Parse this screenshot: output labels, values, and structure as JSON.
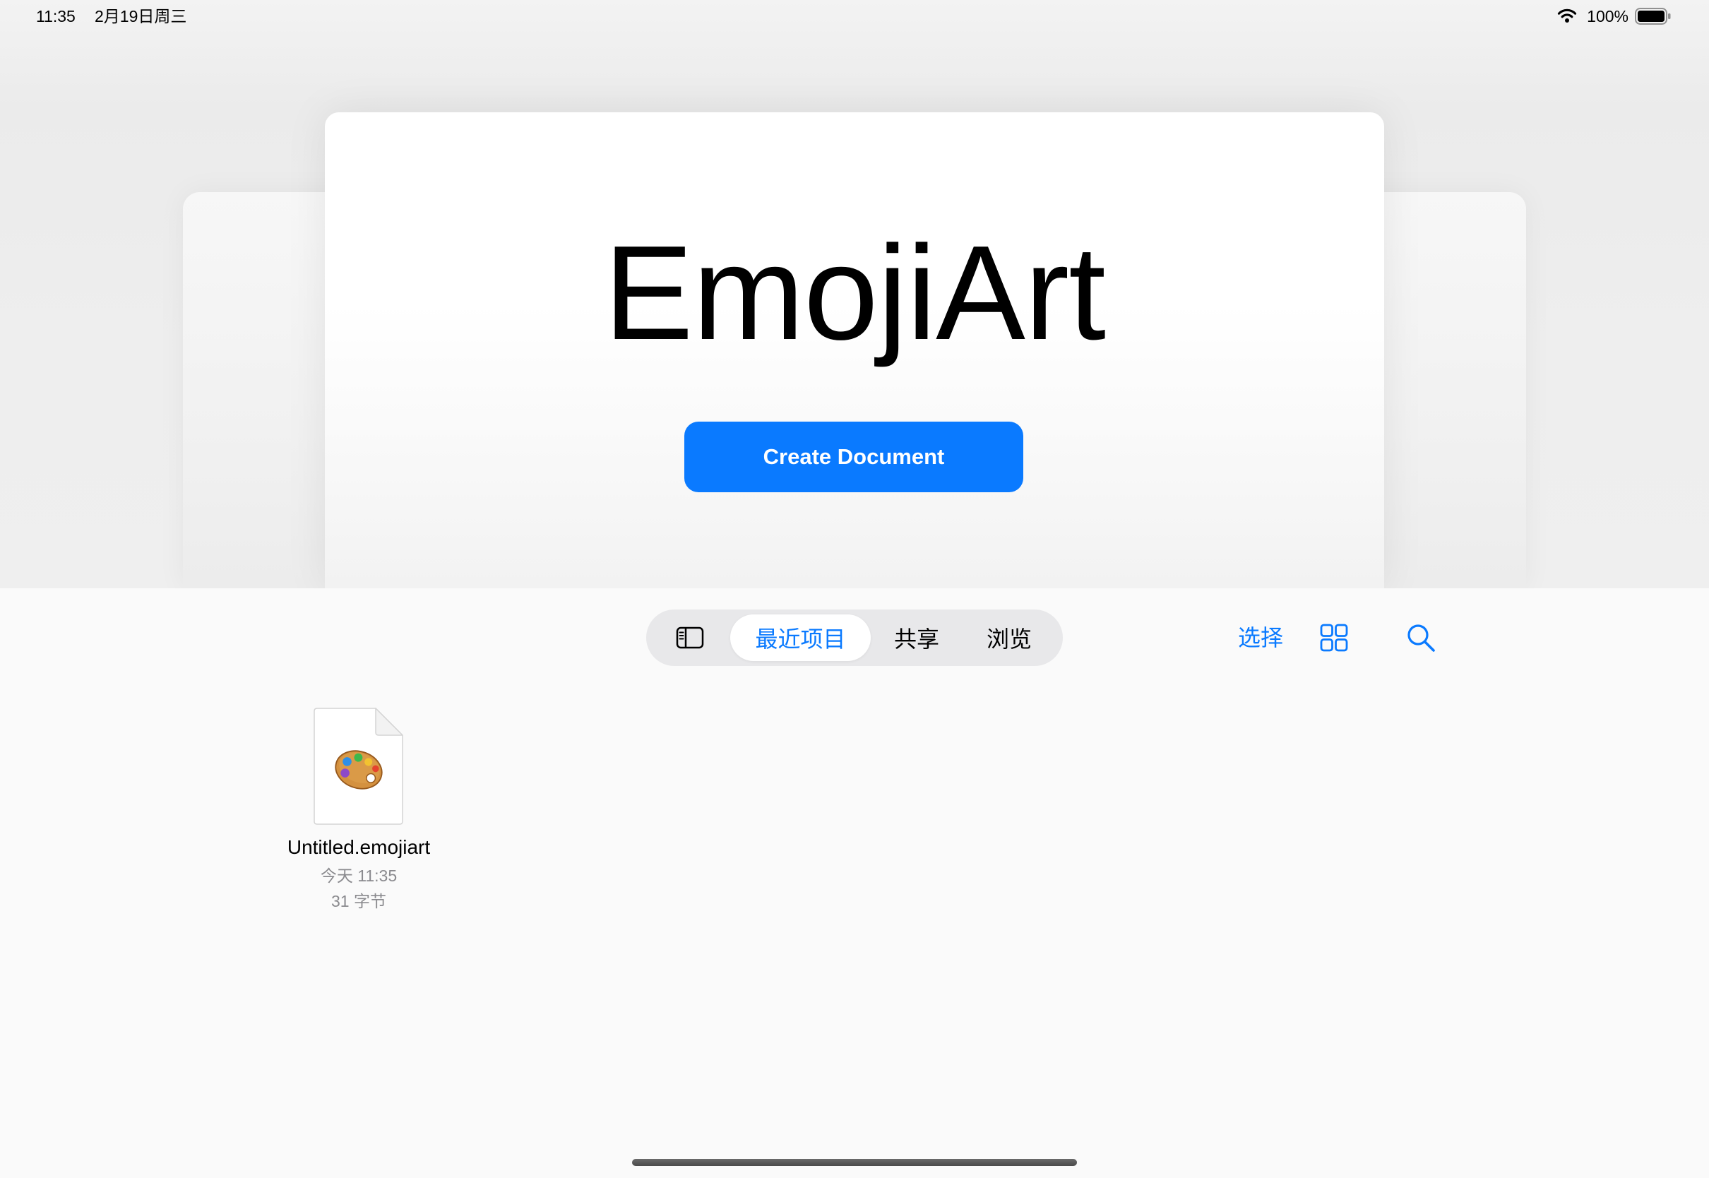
{
  "status_bar": {
    "time": "11:35",
    "date": "2月19日周三",
    "battery_percent": "100%",
    "icons": [
      "wifi-icon",
      "battery-icon"
    ]
  },
  "hero": {
    "title": "EmojiArt",
    "create_button_label": "Create Document"
  },
  "browser_toolbar": {
    "sidebar_toggle_icon": "sidebar-icon",
    "tabs": [
      {
        "label": "最近项目",
        "selected": true
      },
      {
        "label": "共享",
        "selected": false
      },
      {
        "label": "浏览",
        "selected": false
      }
    ],
    "select_label": "选择",
    "view_toggle_icon": "grid-icon",
    "search_icon": "search-icon"
  },
  "files": [
    {
      "name": "Untitled.emojiart",
      "modified": "今天 11:35",
      "size": "31 字节",
      "thumbnail_icon": "palette-icon"
    }
  ],
  "colors": {
    "accent": "#0a7aff",
    "button_text": "#ffffff",
    "segment_background": "#e8e8ea",
    "secondary_text": "#8a8a8e",
    "browser_background": "#fafafa"
  }
}
